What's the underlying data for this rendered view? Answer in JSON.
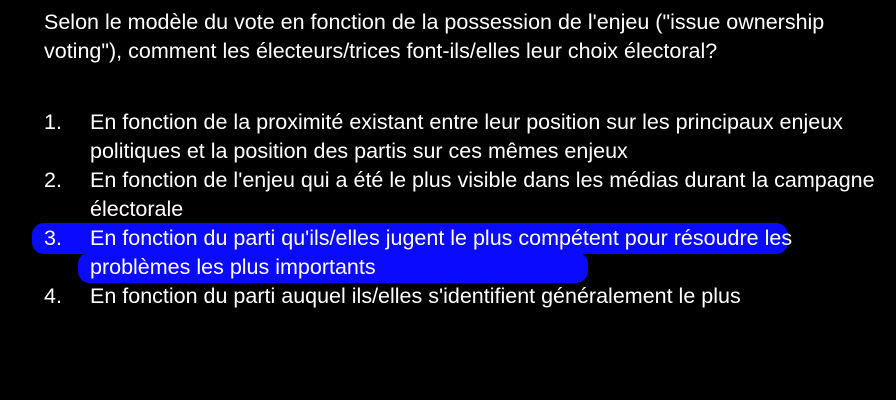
{
  "question": "Selon le modèle du vote en fonction de la possession de l'enjeu (\"issue ownership voting\"), comment les électeurs/trices font-ils/elles leur choix électoral?",
  "options": [
    {
      "number": "1.",
      "text": "En fonction de la proximité existant entre leur position sur les principaux enjeux politiques et la position des partis sur ces mêmes enjeux"
    },
    {
      "number": "2.",
      "text": "En fonction de l'enjeu qui a été le plus visible dans les médias durant la campagne électorale"
    },
    {
      "number": "3.",
      "text": "En fonction du parti qu'ils/elles jugent le plus compétent pour résoudre les problèmes les plus importants"
    },
    {
      "number": "4.",
      "text": "En fonction du parti auquel ils/elles s'identifient généralement le plus"
    }
  ],
  "highlighted_option": 3,
  "colors": {
    "background": "#000000",
    "text": "#ffffff",
    "highlight": "#0a0aff"
  }
}
